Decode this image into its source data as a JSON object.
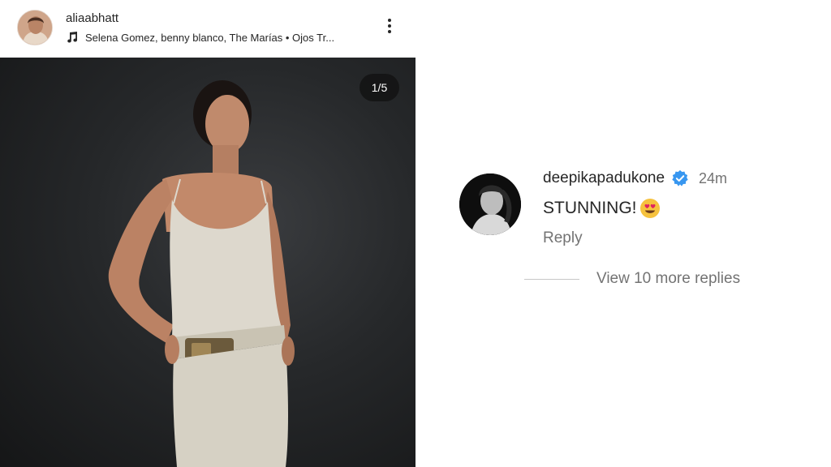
{
  "post": {
    "author": "aliaabhatt",
    "music": "Selena Gomez, benny blanco, The Marías • Ojos Tr...",
    "carousel_counter": "1/5"
  },
  "comment": {
    "username": "deepikapadukone",
    "time": "24m",
    "text": "STUNNING!",
    "reply_label": "Reply",
    "view_replies_label": "View 10 more replies"
  },
  "colors": {
    "verified_badge": "#3897f0",
    "secondary_text": "#737373",
    "primary_text": "#262626"
  },
  "icons": {
    "music": "music-note-icon",
    "more": "more-vertical-icon",
    "verified": "verified-badge-icon",
    "emoji": "heart-eyes-emoji"
  }
}
